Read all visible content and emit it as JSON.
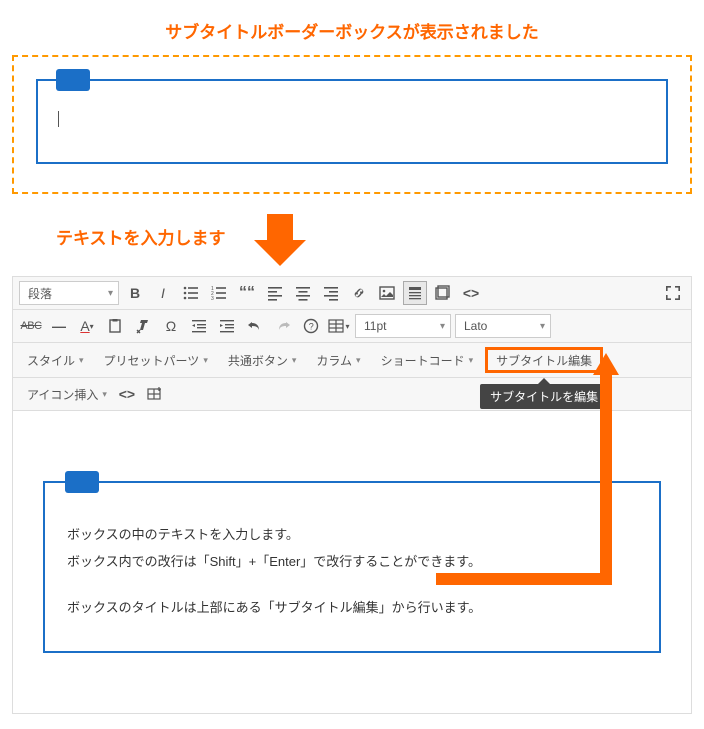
{
  "heading1": "サブタイトルボーダーボックスが表示されました",
  "heading2": "テキストを入力します",
  "toolbar": {
    "paragraph": "段落",
    "fontsize": "11pt",
    "fontfamily": "Lato",
    "style": "スタイル",
    "preset": "プリセットパーツ",
    "common_button": "共通ボタン",
    "column": "カラム",
    "shortcode": "ショートコード",
    "subtitle_edit": "サブタイトル編集",
    "icon_insert": "アイコン挿入"
  },
  "tooltip": "サブタイトルを編集",
  "content": {
    "line1": "ボックスの中のテキストを入力します。",
    "line2": "ボックス内での改行は「Shift」+「Enter」で改行することができます。",
    "line3": "ボックスのタイトルは上部にある「サブタイトル編集」から行います。"
  }
}
